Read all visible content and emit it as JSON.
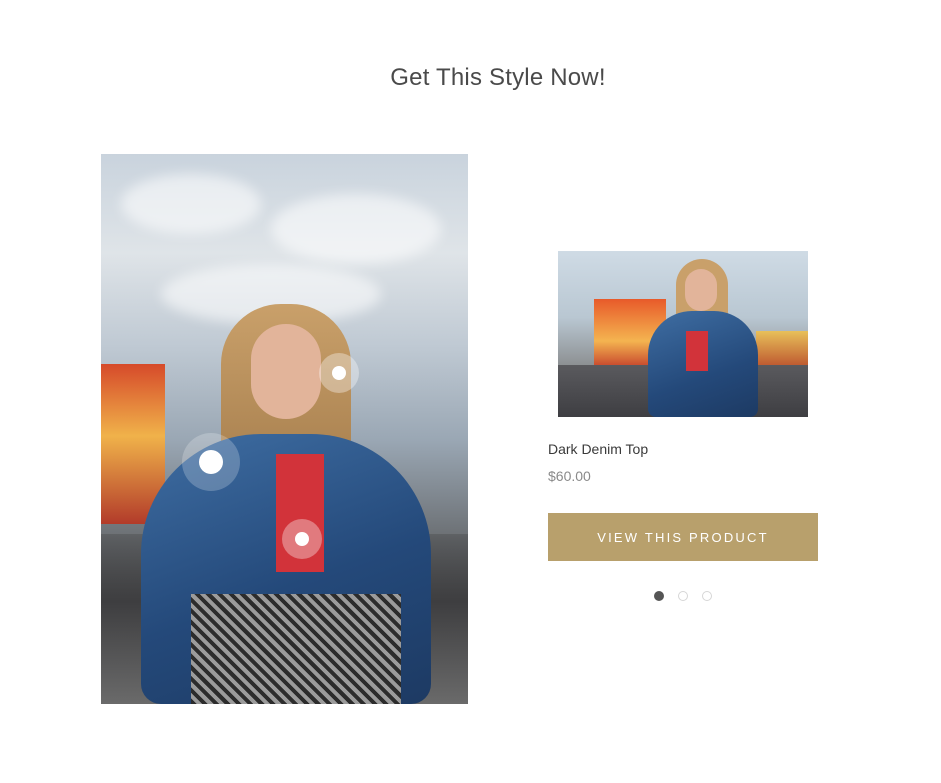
{
  "header": {
    "title": "Get This Style Now!"
  },
  "hero": {
    "image_alt": "Woman in denim jacket at a fair",
    "hotspots": [
      {
        "name": "hotspot-sunglasses",
        "active": false
      },
      {
        "name": "hotspot-jacket",
        "active": true
      },
      {
        "name": "hotspot-top",
        "active": false
      }
    ]
  },
  "product": {
    "name": "Dark Denim Top",
    "price": "$60.00",
    "button_label": "VIEW THIS PRODUCT"
  },
  "pager": {
    "count": 3,
    "active_index": 0
  },
  "colors": {
    "accent": "#b8a06c",
    "title": "#4a4a4a",
    "price": "#8a8a8a"
  }
}
